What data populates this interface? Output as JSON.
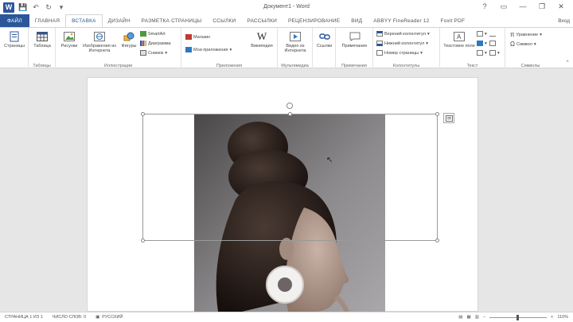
{
  "window": {
    "title": "Документ1 - Word"
  },
  "qat": {
    "logo": "W",
    "save": "💾",
    "undo": "↶",
    "redo": "↻"
  },
  "window_buttons": {
    "help": "?",
    "ribbon_options": "▭",
    "minimize": "—",
    "restore": "❐",
    "close": "✕"
  },
  "tabs": [
    {
      "label": "ФАЙЛ"
    },
    {
      "label": "ГЛАВНАЯ"
    },
    {
      "label": "ВСТАВКА"
    },
    {
      "label": "ДИЗАЙН"
    },
    {
      "label": "РАЗМЕТКА СТРАНИЦЫ"
    },
    {
      "label": "ССЫЛКИ"
    },
    {
      "label": "РАССЫЛКИ"
    },
    {
      "label": "РЕЦЕНЗИРОВАНИЕ"
    },
    {
      "label": "ВИД"
    },
    {
      "label": "ABBYY FineReader 12"
    },
    {
      "label": "Foxit PDF"
    }
  ],
  "signin": "Вход",
  "ribbon": {
    "pages": {
      "label": "Страницы",
      "group": ""
    },
    "tables": {
      "table": "Таблица",
      "group": "Таблицы"
    },
    "illustrations": {
      "group": "Иллюстрации",
      "pictures": "Рисунки",
      "online_pictures": "Изображения из Интернета",
      "shapes": "Фигуры",
      "smartart": "SmartArt",
      "chart": "Диаграмма",
      "screenshot": "Снимок"
    },
    "apps": {
      "group": "Приложения",
      "store": "Магазин",
      "my_apps": "Мои приложения",
      "wikipedia": "Википедия"
    },
    "media": {
      "group": "Мультимедиа",
      "online_video": "Видео из Интернета"
    },
    "links": {
      "label": "Ссылки"
    },
    "comments": {
      "group": "Примечания",
      "comment": "Примечание"
    },
    "header_footer": {
      "group": "Колонтитулы",
      "header": "Верхний колонтитул",
      "footer": "Нижний колонтитул",
      "page_number": "Номер страницы"
    },
    "text": {
      "group": "Текст",
      "textbox": "Текстовое поле"
    },
    "symbols": {
      "group": "Символы",
      "equation": "Уравнение",
      "symbol": "Символ"
    }
  },
  "statusbar": {
    "page": "СТРАНИЦА 1 ИЗ 1",
    "words": "ЧИСЛО СЛОВ: 0",
    "language": "РУССКИЙ",
    "zoom": "110%"
  },
  "colors": {
    "accent": "#2b579a",
    "canvas": "#e6e6e6"
  }
}
